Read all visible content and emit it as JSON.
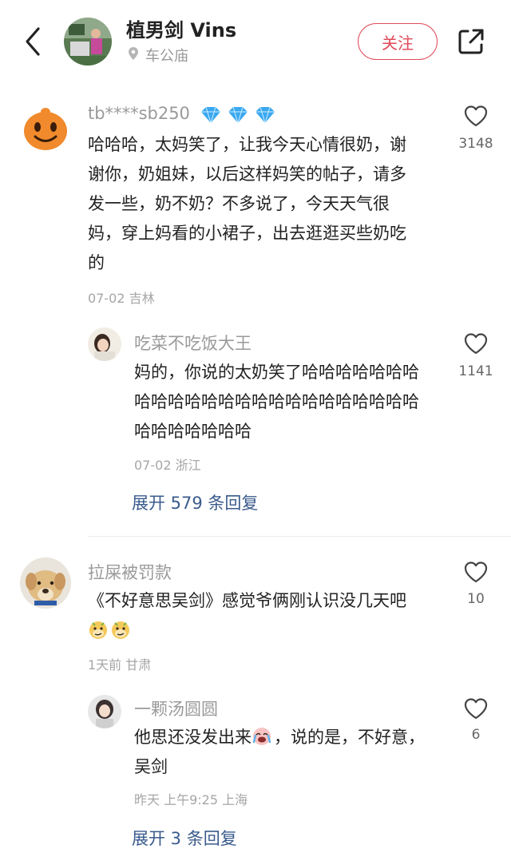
{
  "header": {
    "author_name": "植男剑 Vins",
    "location": "车公庙",
    "follow_label": "关注"
  },
  "comments": [
    {
      "username": "tb****sb250",
      "text": "哈哈哈，太妈笑了，让我今天心情很奶，谢谢你，奶姐妹，以后这样妈笑的帖子，请多发一些，奶不奶？不多说了，今天天气很妈，穿上妈看的小裙子，出去逛逛买些奶吃的",
      "date": "07-02",
      "region": "吉林",
      "likes": "3148"
    },
    {
      "username": "吃菜不吃饭大王",
      "text": "妈的，你说的太奶笑了哈哈哈哈哈哈哈哈哈哈哈哈哈哈哈哈哈哈哈哈哈哈哈哈哈哈哈哈哈哈哈",
      "date": "07-02",
      "region": "浙江",
      "likes": "1141"
    },
    {
      "username": "拉屎被罚款",
      "text": "《不好意思吴剑》感觉爷俩刚认识没几天吧",
      "date": "1天前",
      "region": "甘肃",
      "likes": "10"
    },
    {
      "username": "一颗汤圆圆",
      "text_part1": "他思还没发出来",
      "text_part2": "，说的是，不好意，吴剑",
      "date": "昨天 上午9:25",
      "region": "上海",
      "likes": "6"
    }
  ],
  "expand_1": "展开 579 条回复",
  "expand_2": "展开 3 条回复",
  "icons": {
    "back": "chevron-left-icon",
    "share": "share-icon",
    "like": "heart-outline-icon",
    "location": "location-pin-icon",
    "badge": "diamond-icon"
  },
  "colors": {
    "accent": "#e14a5a",
    "link": "#3a5b8c",
    "secondary_text": "#9a9a9a",
    "diamond": "#3aa8f0"
  }
}
